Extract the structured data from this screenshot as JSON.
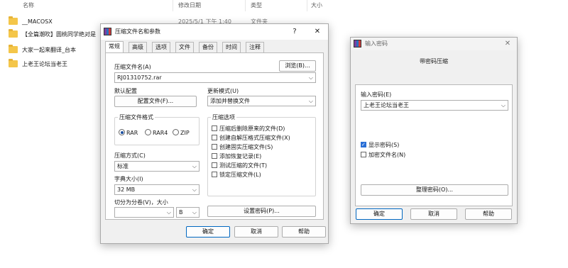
{
  "explorer": {
    "columns": {
      "name": "名称",
      "modified": "修改日期",
      "type": "类型",
      "size": "大小"
    },
    "rows": [
      {
        "name": "__MACOSX",
        "modified": "2025/5/1 下午 1:40",
        "type": "文件夹"
      },
      {
        "name": "【全篇潮吹】圆桃同学绝对是"
      },
      {
        "name": "大家一起来翻译_台本"
      },
      {
        "name": "上老王论坛当老王"
      }
    ]
  },
  "archive_dialog": {
    "title": "压缩文件名和参数",
    "help_glyph": "?",
    "close_glyph": "✕",
    "tabs": [
      "常规",
      "高级",
      "选项",
      "文件",
      "备份",
      "时间",
      "注释"
    ],
    "filename_label": "压缩文件名(A)",
    "browse_button": "浏览(B)...",
    "filename_value": "RJ01310752.rar",
    "default_config_label": "默认配置",
    "profiles_button": "配置文件(F)...",
    "update_mode_label": "更新模式(U)",
    "update_mode_value": "添加并替换文件",
    "format_group_title": "压缩文件格式",
    "format_options": [
      "RAR",
      "RAR4",
      "ZIP"
    ],
    "format_selected": "RAR",
    "method_label": "压缩方式(C)",
    "method_value": "标准",
    "dict_label": "字典大小(I)",
    "dict_value": "32 MB",
    "split_label": "切分为分卷(V)，大小",
    "split_value": "",
    "split_unit": "B",
    "options_group_title": "压缩选项",
    "options": [
      {
        "label": "压缩后删除原来的文件(D)",
        "checked": false
      },
      {
        "label": "创建自解压格式压缩文件(X)",
        "checked": false
      },
      {
        "label": "创建固实压缩文件(S)",
        "checked": false
      },
      {
        "label": "添加恢复记录(E)",
        "checked": false
      },
      {
        "label": "测试压缩的文件(T)",
        "checked": false
      },
      {
        "label": "锁定压缩文件(L)",
        "checked": false
      }
    ],
    "set_password_button": "设置密码(P)...",
    "ok_button": "确定",
    "cancel_button": "取消",
    "help_button": "帮助"
  },
  "password_dialog": {
    "title": "输入密码",
    "close_glyph": "✕",
    "heading": "带密码压缩",
    "enter_label": "输入密码(E)",
    "password_value": "上老王论坛当老王",
    "show_password_label": "显示密码(S)",
    "show_password_checked": true,
    "encrypt_names_label": "加密文件名(N)",
    "encrypt_names_checked": false,
    "organize_button": "整理密码(O)...",
    "ok_button": "确定",
    "cancel_button": "取消",
    "help_button": "帮助"
  },
  "colors": {
    "accent": "#0067c0",
    "folder": "#f4c64a",
    "dialog_bg": "#f0f0f0"
  }
}
